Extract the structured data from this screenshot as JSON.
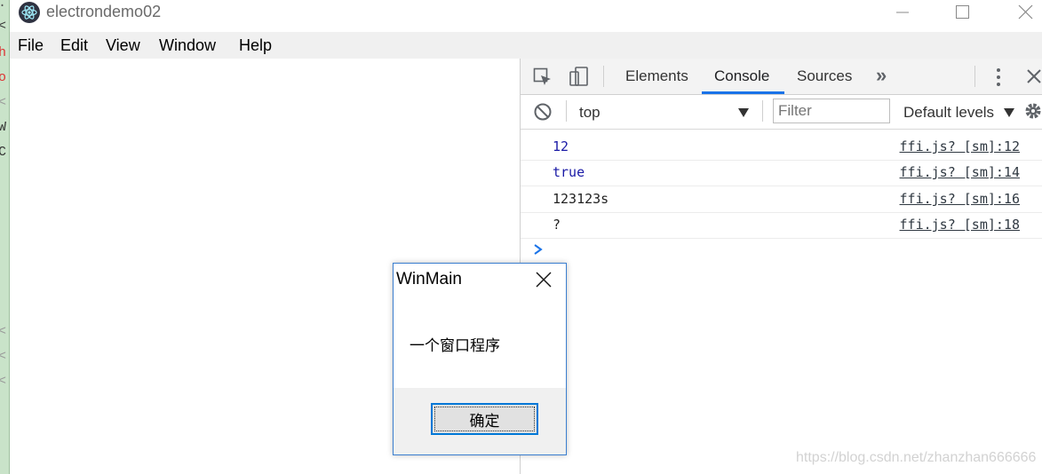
{
  "window": {
    "title": "electrondemo02"
  },
  "background_strip": [
    "..",
    "<",
    "h",
    "o",
    "<",
    "W",
    "C",
    "<",
    "<",
    "<"
  ],
  "menubar": {
    "items": [
      {
        "label": "File"
      },
      {
        "label": "Edit"
      },
      {
        "label": "View"
      },
      {
        "label": "Window"
      },
      {
        "label": "Help"
      }
    ]
  },
  "devtools": {
    "tabs": [
      {
        "label": "Elements"
      },
      {
        "label": "Console",
        "active": true
      },
      {
        "label": "Sources"
      }
    ],
    "more_tabs_glyph": "»",
    "context": "top",
    "filter_placeholder": "Filter",
    "levels": "Default levels",
    "logs": [
      {
        "message": "12",
        "source": "ffi.js? [sm]:12",
        "color": "#1a1aa6"
      },
      {
        "message": "true",
        "source": "ffi.js? [sm]:14",
        "color": "#1a1aa6"
      },
      {
        "message": "123123s",
        "source": "ffi.js? [sm]:16",
        "color": "#222222"
      },
      {
        "message": "?",
        "source": "ffi.js? [sm]:18",
        "color": "#222222"
      }
    ],
    "prompt_glyph": "›"
  },
  "msgbox": {
    "title": "WinMain",
    "text": "一个窗口程序",
    "ok_label": "确定"
  },
  "watermark": "https://blog.csdn.net/zhanzhan666666",
  "colors": {
    "accent": "#1a73e8",
    "dialog_border": "#3c7fd0",
    "button_focus": "#0078d7"
  }
}
